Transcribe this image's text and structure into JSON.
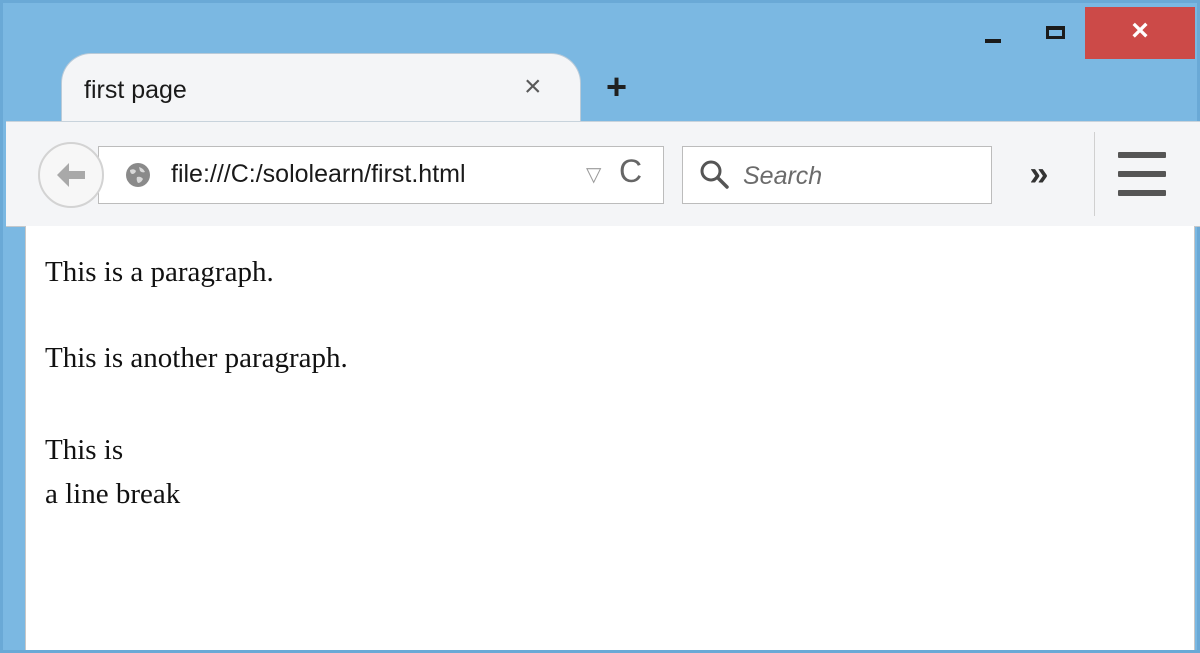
{
  "window": {
    "close_glyph": "×",
    "accent": "#7bb8e2",
    "close_color": "#cc4a48"
  },
  "tab": {
    "title": "first page",
    "close_glyph": "×",
    "new_tab_glyph": "+"
  },
  "toolbar": {
    "back_icon": "arrow-left-icon",
    "url": "file:///C:/sololearn/first.html",
    "dropdown_glyph": "▽",
    "reload_glyph": "C",
    "search_placeholder": "Search",
    "overflow_glyph": "»",
    "menu_icon": "hamburger-icon"
  },
  "page": {
    "paragraph_1": "This is a paragraph.",
    "paragraph_2": "This is another paragraph.",
    "paragraph_3_line_1": "This is",
    "paragraph_3_line_2": "a line break"
  }
}
